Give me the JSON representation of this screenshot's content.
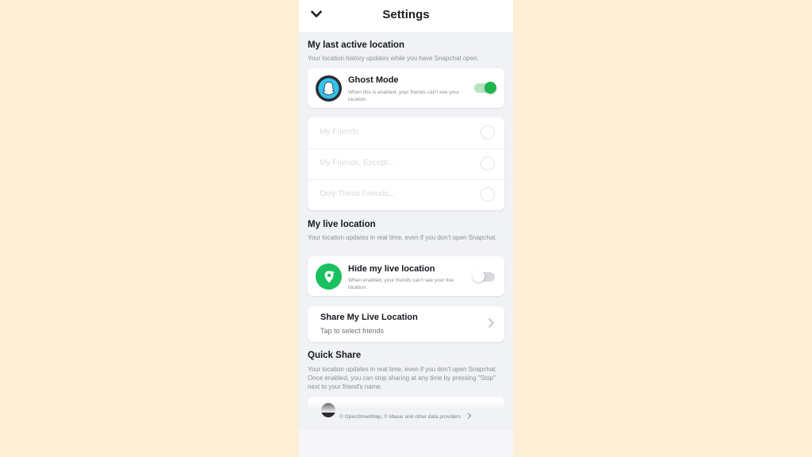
{
  "header": {
    "title": "Settings"
  },
  "last_active": {
    "title": "My last active location",
    "desc": "Your location history updates while you have Snapchat open."
  },
  "ghost_mode": {
    "label": "Ghost Mode",
    "desc": "When this is enabled, your friends can't see your location.",
    "enabled": true
  },
  "audience_options": [
    {
      "label": "My Friends"
    },
    {
      "label": "My Friends, Except..."
    },
    {
      "label": "Only These Friends..."
    }
  ],
  "live_location": {
    "title": "My live location",
    "desc": "Your location updates in real time, even if you don't open Snapchat."
  },
  "hide_live": {
    "label": "Hide my live location",
    "desc": "When enabled, your friends can't see your live location.",
    "enabled": false
  },
  "share_live": {
    "label": "Share My Live Location",
    "sub": "Tap to select friends"
  },
  "quick_share": {
    "title": "Quick Share",
    "desc": "Your location updates in real time, even if you don't open Snapchat. Once enabled, you can stop sharing at any time by pressing \"Stop\" next to your friend's name."
  },
  "footer": {
    "attribution": "© OpenStreetMap, © Maxar and other data providers"
  },
  "colors": {
    "background": "#fdefd6",
    "toggle_on": "#1fb54d",
    "live_icon": "#19c160",
    "ghost_icon": "#33c4ee"
  },
  "icons": {
    "back": "chevron-down-icon",
    "ghost": "ghost-icon",
    "live": "location-pin-icon",
    "share": "chevron-right-icon",
    "footer": "chevron-right-icon"
  }
}
